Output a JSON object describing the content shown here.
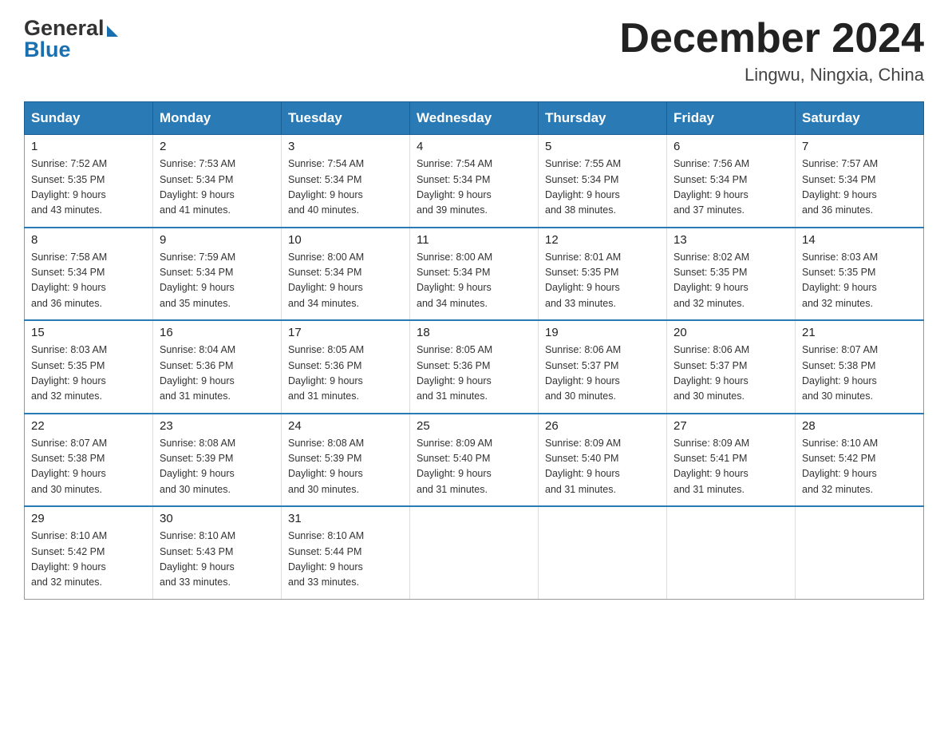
{
  "header": {
    "logo_general": "General",
    "logo_blue": "Blue",
    "month_title": "December 2024",
    "location": "Lingwu, Ningxia, China"
  },
  "days_of_week": [
    "Sunday",
    "Monday",
    "Tuesday",
    "Wednesday",
    "Thursday",
    "Friday",
    "Saturday"
  ],
  "weeks": [
    [
      {
        "day": "1",
        "sunrise": "7:52 AM",
        "sunset": "5:35 PM",
        "daylight": "9 hours and 43 minutes."
      },
      {
        "day": "2",
        "sunrise": "7:53 AM",
        "sunset": "5:34 PM",
        "daylight": "9 hours and 41 minutes."
      },
      {
        "day": "3",
        "sunrise": "7:54 AM",
        "sunset": "5:34 PM",
        "daylight": "9 hours and 40 minutes."
      },
      {
        "day": "4",
        "sunrise": "7:54 AM",
        "sunset": "5:34 PM",
        "daylight": "9 hours and 39 minutes."
      },
      {
        "day": "5",
        "sunrise": "7:55 AM",
        "sunset": "5:34 PM",
        "daylight": "9 hours and 38 minutes."
      },
      {
        "day": "6",
        "sunrise": "7:56 AM",
        "sunset": "5:34 PM",
        "daylight": "9 hours and 37 minutes."
      },
      {
        "day": "7",
        "sunrise": "7:57 AM",
        "sunset": "5:34 PM",
        "daylight": "9 hours and 36 minutes."
      }
    ],
    [
      {
        "day": "8",
        "sunrise": "7:58 AM",
        "sunset": "5:34 PM",
        "daylight": "9 hours and 36 minutes."
      },
      {
        "day": "9",
        "sunrise": "7:59 AM",
        "sunset": "5:34 PM",
        "daylight": "9 hours and 35 minutes."
      },
      {
        "day": "10",
        "sunrise": "8:00 AM",
        "sunset": "5:34 PM",
        "daylight": "9 hours and 34 minutes."
      },
      {
        "day": "11",
        "sunrise": "8:00 AM",
        "sunset": "5:34 PM",
        "daylight": "9 hours and 34 minutes."
      },
      {
        "day": "12",
        "sunrise": "8:01 AM",
        "sunset": "5:35 PM",
        "daylight": "9 hours and 33 minutes."
      },
      {
        "day": "13",
        "sunrise": "8:02 AM",
        "sunset": "5:35 PM",
        "daylight": "9 hours and 32 minutes."
      },
      {
        "day": "14",
        "sunrise": "8:03 AM",
        "sunset": "5:35 PM",
        "daylight": "9 hours and 32 minutes."
      }
    ],
    [
      {
        "day": "15",
        "sunrise": "8:03 AM",
        "sunset": "5:35 PM",
        "daylight": "9 hours and 32 minutes."
      },
      {
        "day": "16",
        "sunrise": "8:04 AM",
        "sunset": "5:36 PM",
        "daylight": "9 hours and 31 minutes."
      },
      {
        "day": "17",
        "sunrise": "8:05 AM",
        "sunset": "5:36 PM",
        "daylight": "9 hours and 31 minutes."
      },
      {
        "day": "18",
        "sunrise": "8:05 AM",
        "sunset": "5:36 PM",
        "daylight": "9 hours and 31 minutes."
      },
      {
        "day": "19",
        "sunrise": "8:06 AM",
        "sunset": "5:37 PM",
        "daylight": "9 hours and 30 minutes."
      },
      {
        "day": "20",
        "sunrise": "8:06 AM",
        "sunset": "5:37 PM",
        "daylight": "9 hours and 30 minutes."
      },
      {
        "day": "21",
        "sunrise": "8:07 AM",
        "sunset": "5:38 PM",
        "daylight": "9 hours and 30 minutes."
      }
    ],
    [
      {
        "day": "22",
        "sunrise": "8:07 AM",
        "sunset": "5:38 PM",
        "daylight": "9 hours and 30 minutes."
      },
      {
        "day": "23",
        "sunrise": "8:08 AM",
        "sunset": "5:39 PM",
        "daylight": "9 hours and 30 minutes."
      },
      {
        "day": "24",
        "sunrise": "8:08 AM",
        "sunset": "5:39 PM",
        "daylight": "9 hours and 30 minutes."
      },
      {
        "day": "25",
        "sunrise": "8:09 AM",
        "sunset": "5:40 PM",
        "daylight": "9 hours and 31 minutes."
      },
      {
        "day": "26",
        "sunrise": "8:09 AM",
        "sunset": "5:40 PM",
        "daylight": "9 hours and 31 minutes."
      },
      {
        "day": "27",
        "sunrise": "8:09 AM",
        "sunset": "5:41 PM",
        "daylight": "9 hours and 31 minutes."
      },
      {
        "day": "28",
        "sunrise": "8:10 AM",
        "sunset": "5:42 PM",
        "daylight": "9 hours and 32 minutes."
      }
    ],
    [
      {
        "day": "29",
        "sunrise": "8:10 AM",
        "sunset": "5:42 PM",
        "daylight": "9 hours and 32 minutes."
      },
      {
        "day": "30",
        "sunrise": "8:10 AM",
        "sunset": "5:43 PM",
        "daylight": "9 hours and 33 minutes."
      },
      {
        "day": "31",
        "sunrise": "8:10 AM",
        "sunset": "5:44 PM",
        "daylight": "9 hours and 33 minutes."
      },
      null,
      null,
      null,
      null
    ]
  ],
  "labels": {
    "sunrise": "Sunrise:",
    "sunset": "Sunset:",
    "daylight": "Daylight:"
  }
}
